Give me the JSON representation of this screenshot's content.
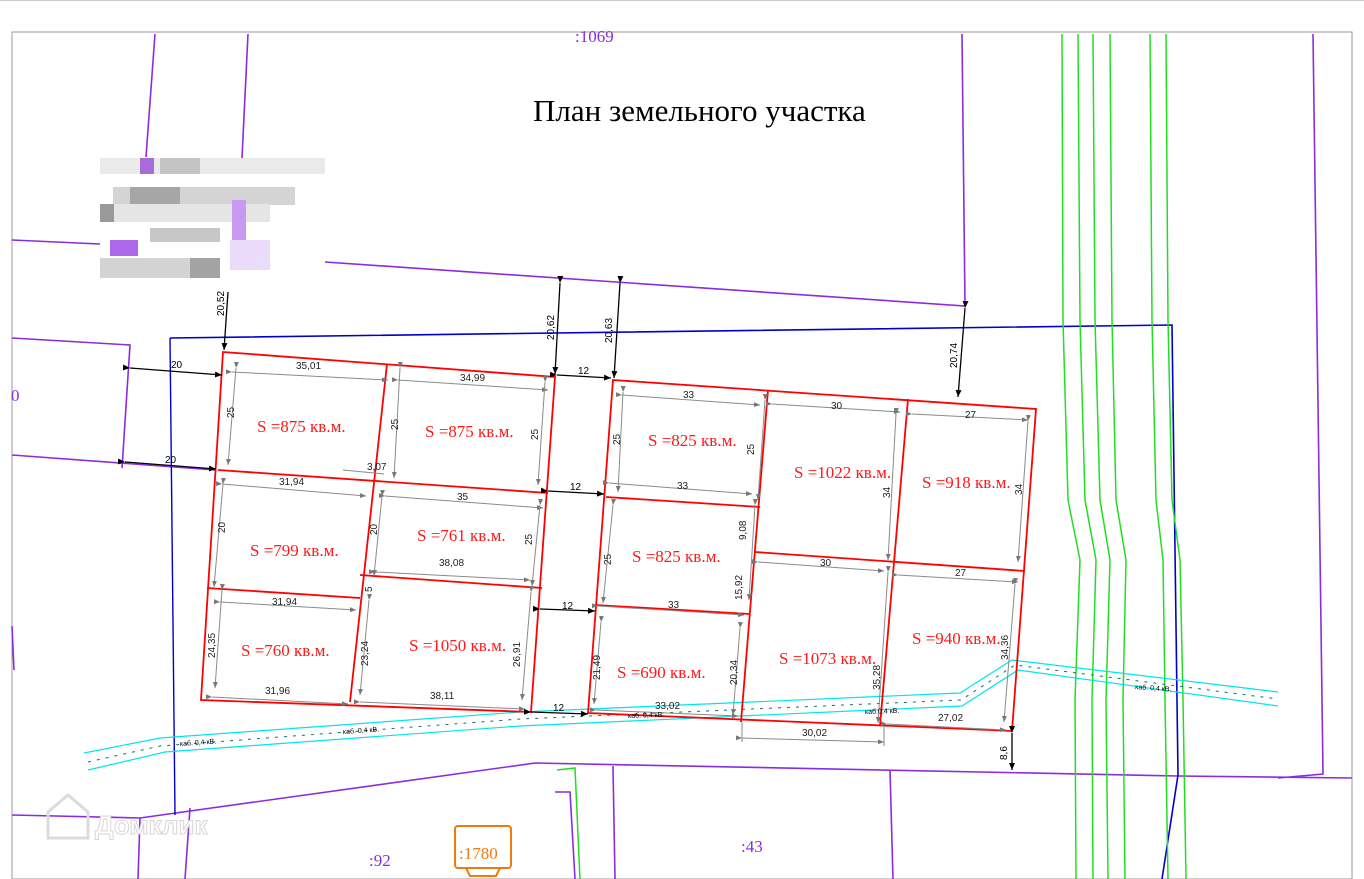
{
  "title": "План земельного участка",
  "parcels": {
    "top": ":1069",
    "left": "0",
    "bottom_left": ":92",
    "bottom_mid": ":43",
    "badge": ":1780"
  },
  "lots": [
    {
      "area": "S =875 кв.м."
    },
    {
      "area": "S =875 кв.м."
    },
    {
      "area": "S =799 кв.м."
    },
    {
      "area": "S =761 кв.м."
    },
    {
      "area": "S =760 кв.м."
    },
    {
      "area": "S =1050 кв.м."
    },
    {
      "area": "S =825 кв.м."
    },
    {
      "area": "S =825 кв.м."
    },
    {
      "area": "S =690 кв.м."
    },
    {
      "area": "S =1022 кв.м."
    },
    {
      "area": "S =918 кв.м."
    },
    {
      "area": "S =1073 кв.м."
    },
    {
      "area": "S =940 кв.м."
    }
  ],
  "dimensions": {
    "d01": "35,01",
    "d02": "34,99",
    "d03": "33",
    "d04": "30",
    "d05": "27",
    "d06": "25",
    "d07": "25",
    "d08": "25",
    "d09": "25",
    "d10": "25",
    "d11": "3,07",
    "d12": "31,94",
    "d13": "35",
    "d14": "33",
    "d15": "20",
    "d16": "20",
    "d17": "25",
    "d18": "9,08",
    "d19": "38,08",
    "d20": "30",
    "d21": "27",
    "d22": "34",
    "d23": "34",
    "d24": "31,94",
    "d25": "5",
    "d26": "33",
    "d27": "15,92",
    "d28": "24,35",
    "d29": "23,24",
    "d30": "26,91",
    "d31": "21,49",
    "d32": "20,34",
    "d33": "35,28",
    "d34": "34,36",
    "d35": "31,96",
    "d36": "38,11",
    "d37": "33,02",
    "d38": "27,02",
    "d39": "30,02",
    "o1": "20,52",
    "o2": "20,62",
    "o3": "20,63",
    "o4": "20,74",
    "o5": "8,6",
    "o6": "20",
    "o7": "20",
    "o8": "12",
    "o9": "12",
    "o10": "12",
    "o11": "12"
  },
  "cables": [
    "каб. 0,4 кВ.",
    "каб. 0,4 кВ.",
    "каб. 0,4 кВ.",
    "каб.0,4 кВ.",
    "каб. 0,4 кВ."
  ],
  "watermark": "Домклик",
  "colors": {
    "parcel_boundary": "#8a2be2",
    "plot_outline": "#ff0000",
    "outer_boundary": "#0000cc",
    "road_lines": "#22dd22",
    "cable_corridor": "#00e5ee",
    "badge": "#f07a10"
  }
}
